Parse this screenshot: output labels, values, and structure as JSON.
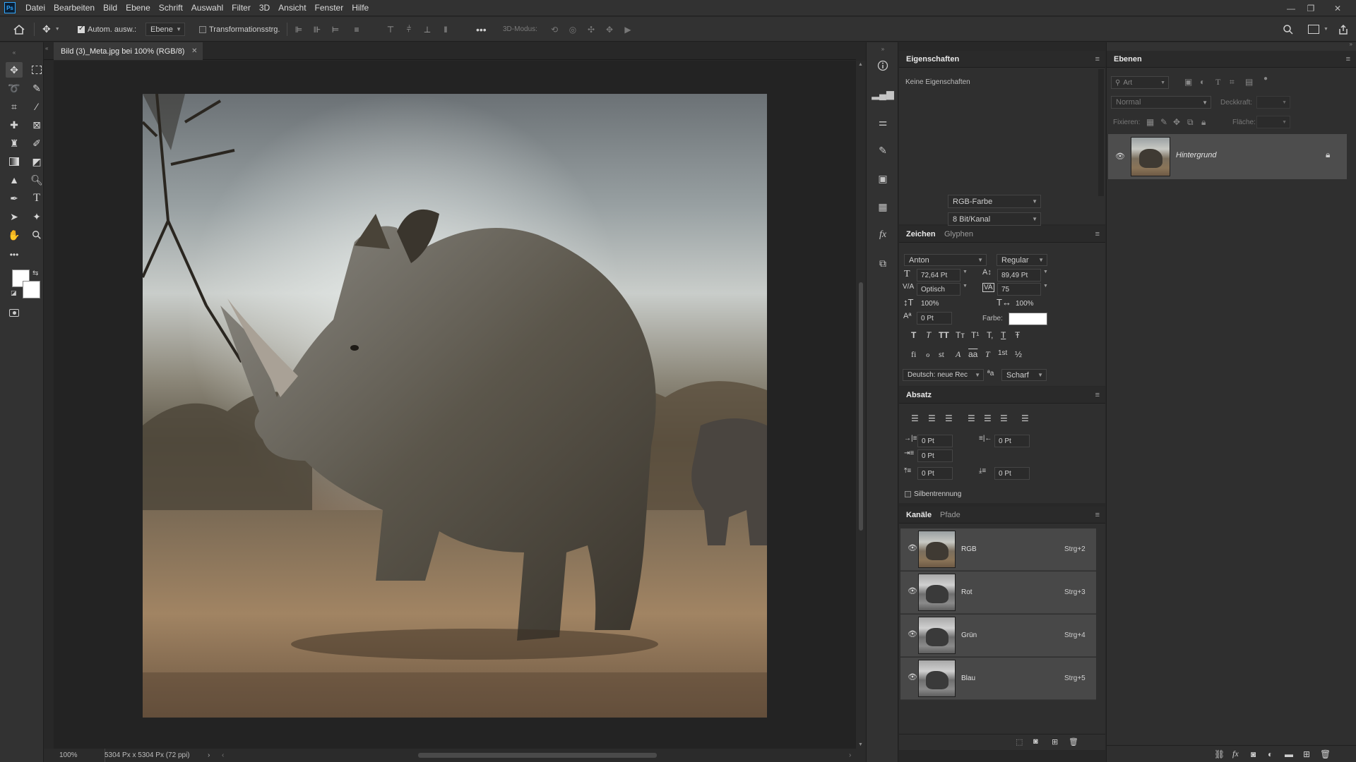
{
  "menu": {
    "logo": "Ps",
    "items": [
      "Datei",
      "Bearbeiten",
      "Bild",
      "Ebene",
      "Schrift",
      "Auswahl",
      "Filter",
      "3D",
      "Ansicht",
      "Fenster",
      "Hilfe"
    ]
  },
  "window_controls": {
    "minimize": "—",
    "restore": "❐",
    "close": "✕"
  },
  "options": {
    "auto_select_label": "Autom. ausw.:",
    "auto_select_checked": true,
    "target_value": "Ebene",
    "transform_label": "Transformationsstrg.",
    "transform_checked": false,
    "more": "•••",
    "mode_3d_label": "3D-Modus:"
  },
  "document": {
    "tab_title": "Bild (3)_Meta.jpg bei 100% (RGB/8)",
    "zoom": "100%",
    "doc_info": "5304 Px x 5304 Px (72 ppi)"
  },
  "properties_panel": {
    "tab": "Eigenschaften",
    "no_props": "Keine Eigenschaften",
    "color_mode": "RGB-Farbe",
    "bit_depth": "8 Bit/Kanal"
  },
  "character_panel": {
    "tabs": [
      "Zeichen",
      "Glyphen"
    ],
    "font_family": "Anton",
    "font_style": "Regular",
    "font_size": "72,64 Pt",
    "leading": "89,49 Pt",
    "kerning": "Optisch",
    "tracking": "75",
    "vertical_scale": "100%",
    "horizontal_scale": "100%",
    "baseline_shift": "0 Pt",
    "color_label": "Farbe:",
    "color_value": "#ffffff",
    "language": "Deutsch: neue Rec",
    "antialias_label": "ªa",
    "antialias": "Scharf",
    "style_buttons": [
      "T",
      "T",
      "TT",
      "Tт",
      "T¹",
      "T,",
      "T",
      "Ŧ"
    ],
    "opentype_buttons": [
      "fi",
      "ℴ",
      "st",
      "A",
      "aa",
      "T",
      "1st",
      "½"
    ]
  },
  "paragraph_panel": {
    "tab": "Absatz",
    "indent_left": "0 Pt",
    "indent_right": "0 Pt",
    "indent_first": "0 Pt",
    "space_before": "0 Pt",
    "space_after": "0 Pt",
    "hyphenation_label": "Silbentrennung"
  },
  "channels_panel": {
    "tabs": [
      "Kanäle",
      "Pfade"
    ],
    "channels": [
      {
        "name": "RGB",
        "shortcut": "Strg+2"
      },
      {
        "name": "Rot",
        "shortcut": "Strg+3"
      },
      {
        "name": "Grün",
        "shortcut": "Strg+4"
      },
      {
        "name": "Blau",
        "shortcut": "Strg+5"
      }
    ]
  },
  "layers_panel": {
    "tab": "Ebenen",
    "filter_kind": "Art",
    "blend_mode": "Normal",
    "opacity_label": "Deckkraft:",
    "lock_label": "Fixieren:",
    "fill_label": "Fläche:",
    "layers": [
      {
        "name": "Hintergrund",
        "locked": true
      }
    ]
  }
}
